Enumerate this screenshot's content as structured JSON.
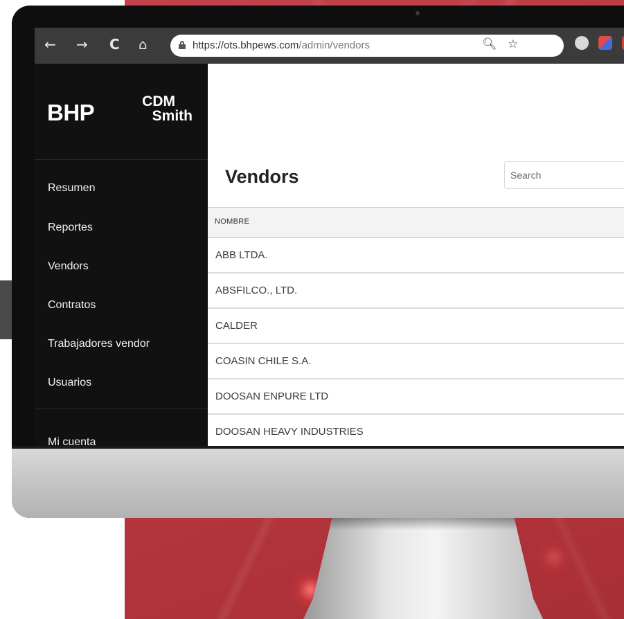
{
  "browser": {
    "url_host": "https://ots.bhpews.com",
    "url_path": "/admin/vendors",
    "nav_icons": [
      "back-arrow-icon",
      "forward-arrow-icon",
      "reload-icon",
      "home-icon"
    ],
    "url_icons": [
      "zoom-icon",
      "star-icon"
    ],
    "extension_icons": [
      "extension-icon-1",
      "extension-icon-2",
      "extension-icon-3"
    ]
  },
  "sidebar": {
    "logo_primary": "BHP",
    "logo_secondary_top": "CDM",
    "logo_secondary_bottom": "Smith",
    "items": [
      {
        "label": "Resumen"
      },
      {
        "label": "Reportes"
      },
      {
        "label": "Vendors"
      },
      {
        "label": "Contratos"
      },
      {
        "label": "Trabajadores vendor"
      },
      {
        "label": "Usuarios"
      },
      {
        "label": "Mi cuenta"
      }
    ]
  },
  "main": {
    "title": "Vendors",
    "search_placeholder": "Search",
    "table": {
      "column_header": "NOMBRE",
      "rows": [
        "ABB LTDA.",
        "ABSFILCO., LTD.",
        "CALDER",
        "COASIN CHILE S.A.",
        "DOOSAN ENPURE LTD",
        "DOOSAN HEAVY INDUSTRIES"
      ]
    }
  },
  "colors": {
    "background_red": "#b9373f",
    "sidebar_bg": "#111111",
    "browser_bar": "#3b3b3b"
  }
}
